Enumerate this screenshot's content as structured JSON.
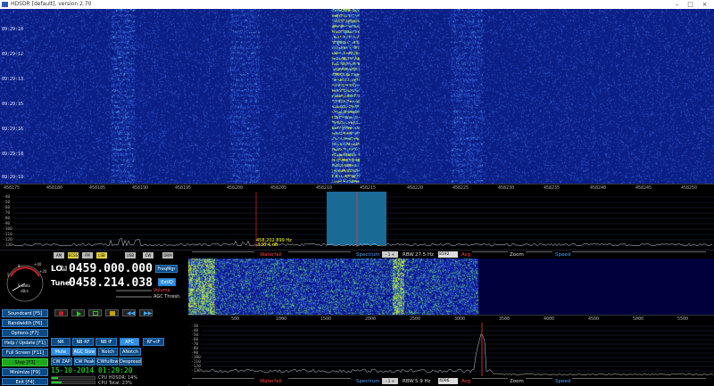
{
  "window": {
    "title": "HDSDR [default], version 2.70"
  },
  "waterfall_top": {
    "time_labels": [
      "09:29:10",
      "09:29:12",
      "09:29:13",
      "09:29:15",
      "09:29:16",
      "09:29:18",
      "09:29:19"
    ]
  },
  "freq_axis": {
    "labels": [
      "458175",
      "458180",
      "458185",
      "458190",
      "458195",
      "458200",
      "458205",
      "458210",
      "458215",
      "458220",
      "458225",
      "458230",
      "458235",
      "458240",
      "458245",
      "458250"
    ]
  },
  "spectrum_top": {
    "db_labels": [
      "-40",
      "-50",
      "-60",
      "-70",
      "-80",
      "-90",
      "-100",
      "-110",
      "-120",
      "-130",
      "-140"
    ],
    "marker_freq": "458,202.899 Hz",
    "marker_level": "-130.4 dB"
  },
  "indicators": [
    "AM",
    "ECSS",
    "FM",
    "LSB",
    "USB",
    "CW",
    "DRM"
  ],
  "smeter": {
    "scale_labels": [
      "+40",
      "+20",
      "9",
      "5"
    ],
    "readout": "S-units",
    "sub": "dBm"
  },
  "lo": {
    "label": "LO",
    "sub": "A",
    "value": "0459.000.000"
  },
  "tune": {
    "label": "Tune",
    "value": "0458.214.038"
  },
  "right_buttons": {
    "freqmgr": "FreqMgr",
    "ext": "ExtIO"
  },
  "volume_label": "Volume",
  "agc_label": "AGC Thresh.",
  "left_buttons": [
    {
      "label": "Soundcard [F5]",
      "green": false
    },
    {
      "label": "Bandwidth [F6]",
      "green": false
    },
    {
      "label": "Options [F7]",
      "green": false
    },
    {
      "label": "Help / Update [F1]",
      "green": false
    },
    {
      "label": "Full Screen [F11]",
      "green": false
    },
    {
      "label": "Stop [F3]",
      "green": true
    },
    {
      "label": "Minimize [F9]",
      "green": false
    },
    {
      "label": "Exit [F4]",
      "green": false
    }
  ],
  "dsp_row1": [
    "NR",
    "NB RF",
    "NB IF",
    "AFC",
    "RF+IF"
  ],
  "dsp_row2": [
    "Mute",
    "AGC Slow",
    "Notch",
    "ANotch"
  ],
  "dsp_row3": [
    "CW ZAP",
    "CW Peak",
    "CWfullbw",
    "Despread"
  ],
  "datetime": "15-10-2014  01:29:20",
  "cpu": {
    "hdsdr": "CPU HDSDR:  14%",
    "total": "CPU Total:  23%"
  },
  "bar1": {
    "waterfall": "Waterfall",
    "spectrum": "Spectrum",
    "rbw": "RBW",
    "rbw_val": "27.5 Hz",
    "avg": "Avg",
    "zoom": "Zoom",
    "speed": "Speed",
    "fft": "8192"
  },
  "bar2": {
    "waterfall": "Waterfall",
    "spectrum": "Spectrum",
    "rbw": "RBW",
    "rbw_val": "5.9 Hz",
    "avg": "Avg",
    "zoom": "Zoom",
    "speed": "Speed",
    "fft": "4096"
  },
  "axis2": {
    "labels": [
      "500",
      "1000",
      "1500",
      "2000",
      "2500",
      "3000",
      "3500",
      "4000",
      "4500",
      "5000",
      "5500"
    ]
  },
  "spec2": {
    "db_labels": [
      "-30",
      "-40",
      "-50",
      "-60",
      "-70",
      "-80",
      "-90",
      "-100",
      "-110",
      "-120",
      "-130",
      "-140"
    ]
  },
  "colors": {
    "waterfall": "#0c1f86",
    "green": "#1ea61e",
    "button": "#0a4a86",
    "red": "#ff3030",
    "yellow": "#ffff00"
  }
}
